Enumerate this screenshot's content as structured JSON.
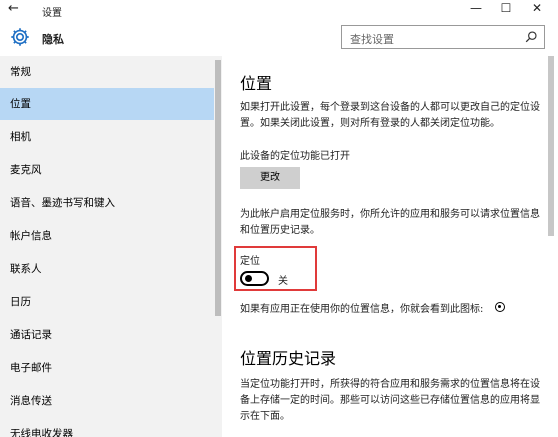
{
  "window": {
    "back_glyph": "←",
    "title": "设置",
    "minimize_glyph": "—",
    "maximize_glyph": "☐",
    "close_glyph": "✕"
  },
  "header": {
    "icon": "gear-icon",
    "title": "隐私",
    "search_placeholder": "查找设置",
    "search_icon": "search-icon"
  },
  "sidebar": {
    "items": [
      {
        "label": "常规",
        "selected": false
      },
      {
        "label": "位置",
        "selected": true
      },
      {
        "label": "相机",
        "selected": false
      },
      {
        "label": "麦克风",
        "selected": false
      },
      {
        "label": "语音、墨迹书写和键入",
        "selected": false
      },
      {
        "label": "帐户信息",
        "selected": false
      },
      {
        "label": "联系人",
        "selected": false
      },
      {
        "label": "日历",
        "selected": false
      },
      {
        "label": "通话记录",
        "selected": false
      },
      {
        "label": "电子邮件",
        "selected": false
      },
      {
        "label": "消息传送",
        "selected": false
      },
      {
        "label": "无线电收发器",
        "selected": false
      }
    ]
  },
  "main": {
    "section_title": "位置",
    "intro_text": "如果打开此设置，每个登录到这台设备的人都可以更改自己的定位设置。如果关闭此设置，则对所有登录的人都关闭定位功能。",
    "device_status": "此设备的定位功能已打开",
    "change_button": "更改",
    "account_text": "为此帐户启用定位服务时，你所允许的应用和服务可以请求位置信息和位置历史记录。",
    "toggle_title": "定位",
    "toggle_state": "关",
    "toggle_on": false,
    "icon_note": "如果有应用正在使用你的位置信息，你就会看到此图标:",
    "icon_note_icon": "location-dot-icon",
    "history_title": "位置历史记录",
    "history_text": "当定位功能打开时，所获得的符合应用和服务需求的位置信息将在设备上存储一定的时间。那些可以访问这些已存储位置信息的应用将显示在下面。",
    "highlight_color": "#e03a3a",
    "selected_color": "#b7d7f4"
  }
}
